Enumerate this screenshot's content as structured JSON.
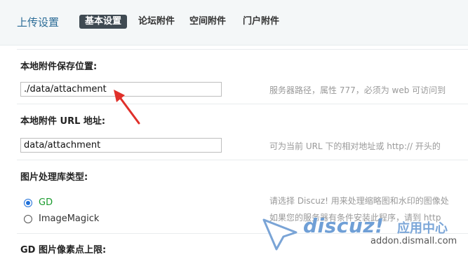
{
  "header": {
    "title": "上传设置",
    "tabs": [
      {
        "label": "基本设置",
        "active": true
      },
      {
        "label": "论坛附件",
        "active": false
      },
      {
        "label": "空间附件",
        "active": false
      },
      {
        "label": "门户附件",
        "active": false
      }
    ]
  },
  "settings": {
    "attach_dir": {
      "label": "本地附件保存位置:",
      "value": "./data/attachment",
      "hint": "服务器路径，属性 777，必须为 web 可访问到"
    },
    "attach_url": {
      "label": "本地附件 URL 地址:",
      "value": "data/attachment",
      "hint": "可为当前 URL 下的相对地址或 http:// 开头的"
    },
    "image_lib": {
      "label": "图片处理库类型:",
      "options": [
        {
          "label": "GD",
          "checked": true,
          "color": "#1a9b2e"
        },
        {
          "label": "ImageMagick",
          "checked": false
        }
      ],
      "hint_line1": "请选择 Discuz! 用来处理缩略图和水印的图像处",
      "hint_line2": "如果您的服务器有条件安装此程序，请到 http"
    },
    "gd_limit": {
      "label": "GD 图片像素点上限:"
    }
  },
  "watermark": {
    "brand": "discuz!",
    "subtitle": "应用中心",
    "domain": "addon.dismall.com"
  },
  "colors": {
    "accent": "#2a6b96",
    "active_tab_bg": "#3f4a52",
    "arrow": "#e0302a",
    "radio_checked": "#1e6fd9"
  }
}
